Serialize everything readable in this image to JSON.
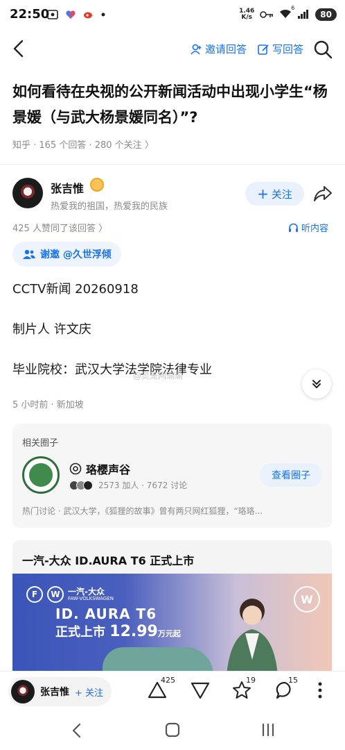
{
  "status_bar": {
    "time": "22:50",
    "net_speed_value": "1.46",
    "net_speed_unit": "K/s",
    "wifi_num": "6",
    "battery": "80"
  },
  "nav": {
    "invite_label": "邀请回答",
    "write_label": "写回答"
  },
  "question": {
    "title": "如何看待在央视的公开新闻活动中出现小学生“杨景媛（与武大杨景媛同名）”?",
    "meta": "知乎 · 165 个回答 · 280 个关注 〉"
  },
  "answer": {
    "author_name": "张吉惟",
    "author_bio": "热爱我的祖国，热爱我的民族",
    "follow_label": "关注",
    "upvote_text": "425 人赞同了该回答 〉",
    "listen_label": "听内容",
    "invite_chip": "谢邀 @久世浮倾",
    "paragraphs": [
      "CCTV新闻 20260918",
      "制片人 许文庆",
      "毕业院校：武汉大学法学院法律专业"
    ],
    "watermark": "@灵笼网瑜瑜",
    "post_time": "5 小时前 · 新加坡"
  },
  "circle": {
    "section_label": "相关圈子",
    "name": "珞樱声谷",
    "stats": "2573 加人 · 7672 讨论",
    "view_label": "查看圈子",
    "hot": "热门讨论 · 武汉大学，《狐狸的故事》曾有两只网红狐狸，“珞珞..."
  },
  "ad": {
    "title": "一汽-大众 ID.AURA T6 正式上市",
    "brand_cn": "一汽-大众",
    "brand_en": "FAW-VOLKSWAGEN",
    "model": "ID. AURA T6",
    "launch": "正式上市",
    "price": "12.99",
    "price_unit": "万元起"
  },
  "bottom_bar": {
    "author_name": "张吉惟",
    "follow_label": "+ 关注",
    "upvote_count": "425",
    "favorite_count": "19",
    "comment_count": "15"
  },
  "colors": {
    "accent": "#1772f6",
    "muted": "#8a8a8a"
  }
}
